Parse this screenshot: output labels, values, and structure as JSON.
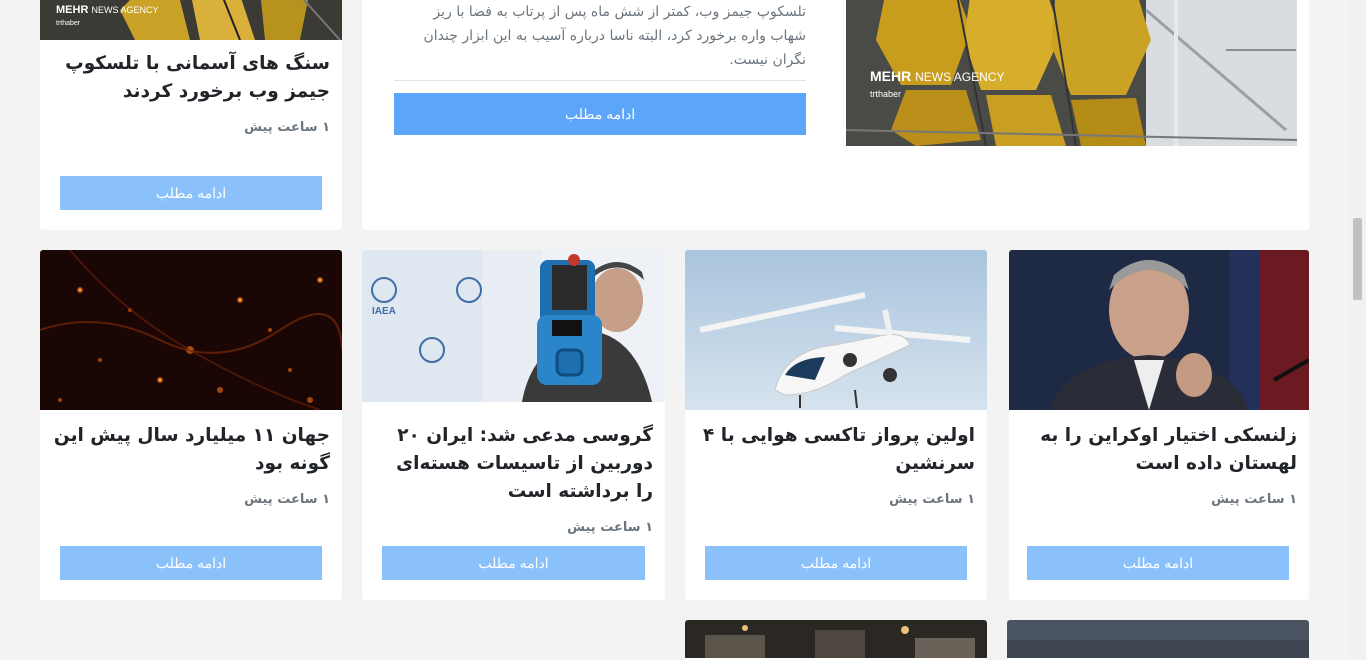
{
  "featured": {
    "left_card": {
      "title": "سنگ های آسمانی با تلسکوپ جیمز وب برخورد کردند",
      "time": "۱ ساعت پیش",
      "button": "ادامه مطلب",
      "watermark": {
        "brand": "MEHR",
        "agency": "NEWS AGENCY",
        "source": "trthaber"
      }
    },
    "main_card": {
      "excerpt": "تلسکوپ جیمز وب، کمتر از شش ماه پس از پرتاب به فضا با ریز شهاب واره برخورد کرد، البته ناسا درباره آسیب به این ابزار چندان نگران نیست.",
      "button": "ادامه مطلب",
      "watermark": {
        "brand": "MEHR",
        "agency": "NEWS AGENCY",
        "source": "trthaber"
      }
    }
  },
  "grid": [
    {
      "title": "زلنسکی اختیار اوکراین را به لهستان داده است",
      "time": "۱ ساعت پیش",
      "button": "ادامه مطلب",
      "image": "politician-photo"
    },
    {
      "title": "اولین پرواز تاکسی هوایی با ۴ سرنشین",
      "time": "۱ ساعت پیش",
      "button": "ادامه مطلب",
      "image": "air-taxi-photo"
    },
    {
      "title": "گروسی مدعی شد: ایران ۲۰ دوربین از تاسیسات هسته‌ای را برداشته است",
      "time": "۱ ساعت پیش",
      "button": "ادامه مطلب",
      "image": "iaea-camera-photo",
      "logo_text": "IAEA"
    },
    {
      "title": "جهان ۱۱ میلیارد سال پیش این گونه بود",
      "time": "۱ ساعت پیش",
      "button": "ادامه مطلب",
      "image": "early-universe-photo"
    }
  ],
  "colors": {
    "page_bg": "#f3f3f4",
    "button": "#8bc1fb",
    "button_strong": "#5ca5f8",
    "title": "#212529",
    "muted": "#6c757d"
  }
}
